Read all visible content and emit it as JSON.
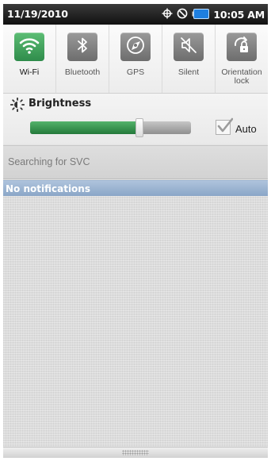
{
  "status_bar": {
    "date": "11/19/2010",
    "time": "10:05 AM",
    "icons": [
      "gps-icon",
      "blocked-icon",
      "battery-icon"
    ]
  },
  "quick_settings": {
    "tiles": [
      {
        "label": "Wi-Fi",
        "icon": "wifi-icon",
        "active": true
      },
      {
        "label": "Bluetooth",
        "icon": "bluetooth-icon",
        "active": false
      },
      {
        "label": "GPS",
        "icon": "gps-icon",
        "active": false
      },
      {
        "label": "Silent",
        "icon": "silent-icon",
        "active": false
      },
      {
        "label": "Orientation lock",
        "icon": "orientation-lock-icon",
        "active": false
      }
    ]
  },
  "brightness": {
    "title": "Brightness",
    "level": 0.68,
    "auto_label": "Auto",
    "auto_checked": true
  },
  "searching": {
    "text": "Searching for SVC"
  },
  "notifications": {
    "header": "No notifications"
  },
  "colors": {
    "accent_green": "#3aa356",
    "header_blue": "#9bb3d1"
  }
}
